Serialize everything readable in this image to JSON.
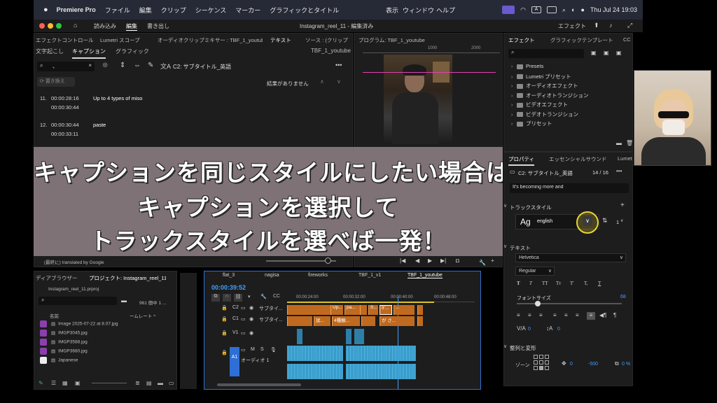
{
  "menubar": {
    "app": "Premiere Pro",
    "items": [
      "ファイル",
      "編集",
      "クリップ",
      "シーケンス",
      "マーカー",
      "グラフィックとタイトル"
    ],
    "right_items": [
      "表示",
      "ウィンドウ",
      "ヘルプ"
    ],
    "datetime": "Thu Jul 24  19:03"
  },
  "titlebar": {
    "tabs": [
      "読み込み",
      "編集",
      "書き出し"
    ],
    "title": "Instagram_reel_11 - 編集済み",
    "workspace": "エフェクト"
  },
  "left_panel": {
    "tabs": [
      "エフェクトコントロール",
      "Lumetri スコープ",
      "オーディオクリップミキサー : TBF_1_youtube",
      "テキスト",
      "ソース : (クリップ"
    ],
    "subtabs": [
      "文字起こし",
      "キャプション",
      "グラフィック"
    ],
    "sequence": "TBF_1_youtube",
    "search": "、",
    "track": "C2: サブタイトル_英語",
    "merge_button": "置き換え",
    "no_results": "結果がありません",
    "captions": [
      {
        "num": "11.",
        "start": "00:00:28:16",
        "end": "00:00:30:44",
        "text": "Up to 4 types of miso"
      },
      {
        "num": "12.",
        "start": "00:00:30:44",
        "end": "00:00:33:11",
        "text": "paste"
      }
    ],
    "footer": "(最終に) translated by Google"
  },
  "program": {
    "tab": "プログラム: TBF_1_youtube",
    "ruler": [
      "1000",
      "2000"
    ]
  },
  "banner": {
    "line1": "キャプションを同じスタイルにしたい場合は",
    "line2": "キャプションを選択して",
    "line3": "トラックスタイルを選べば一発！"
  },
  "effects": {
    "tabs": [
      "エフェクト",
      "グラフィックテンプレート",
      "CC"
    ],
    "items": [
      "Presets",
      "Lumetri プリセット",
      "オーディオエフェクト",
      "オーディオトランジション",
      "ビデオエフェクト",
      "ビデオトランジション",
      "プリセット"
    ]
  },
  "properties": {
    "tabs": [
      "プロパティ",
      "エッセンシャルサウンド",
      "Lumet"
    ],
    "track": "C2: サブタイトル_英語",
    "count": "14 / 16",
    "caption_text": "It's becoming more and",
    "track_style_label": "トラックスタイル",
    "style_name": "english",
    "style_icon": "Ag",
    "style_num": "1",
    "text_label": "テキスト",
    "font": "Helvetica",
    "weight": "Regular",
    "font_size_label": "フォントサイズ",
    "font_size": "68",
    "align_label": "整列と変形",
    "zone_label": "ゾーン",
    "pos_x": "0",
    "pos_y": "-500",
    "val0": "0",
    "val1": "0",
    "rot": "0 %",
    "style_buttons": [
      "T",
      "T",
      "TT",
      "Tт",
      "T'",
      "T,",
      "T"
    ]
  },
  "project": {
    "tabs": [
      "ディアブラウザー",
      "プロジェクト: Instagram_reel_11"
    ],
    "file": "Instagram_reel_11.prproj",
    "search": "",
    "count": "961 個中 1 ...",
    "col_name": "名前",
    "col_rate": "ームレート ^",
    "items": [
      "Image 2025-07-22 at 8.07.jpg",
      "IMGP3045.jpg",
      "IMGP3588.jpg",
      "IMGP3680.jpg",
      "Japanese"
    ]
  },
  "timeline": {
    "tabs": [
      "flat_3",
      "nagisa",
      "fireworks",
      "TBF_1_v1",
      "TBF_1_youtube"
    ],
    "timecode": "00:00:39:52",
    "ruler": [
      "00:00:24:00",
      "00:00:32:00",
      "00:00:40:00",
      "00:00:48:00"
    ],
    "tracks": [
      {
        "id": "C2",
        "name": "サブタイ..."
      },
      {
        "id": "C1",
        "name": "サブタイ..."
      },
      {
        "id": "V1",
        "name": ""
      },
      {
        "id": "A1",
        "name": "オーディオ 1"
      }
    ],
    "c2_clips": [
      "Up...",
      "pa...",
      "S...",
      "It'...",
      "..."
    ],
    "c1_clips": [
      "試...",
      "4種類...",
      "が さ..."
    ]
  },
  "colors": {
    "accent": "#2d8ceb",
    "banner": "#87787d",
    "timecode": "#3fa0ff",
    "caption_clip": "#c06a1f",
    "audio_clip": "#2e7fa8"
  }
}
